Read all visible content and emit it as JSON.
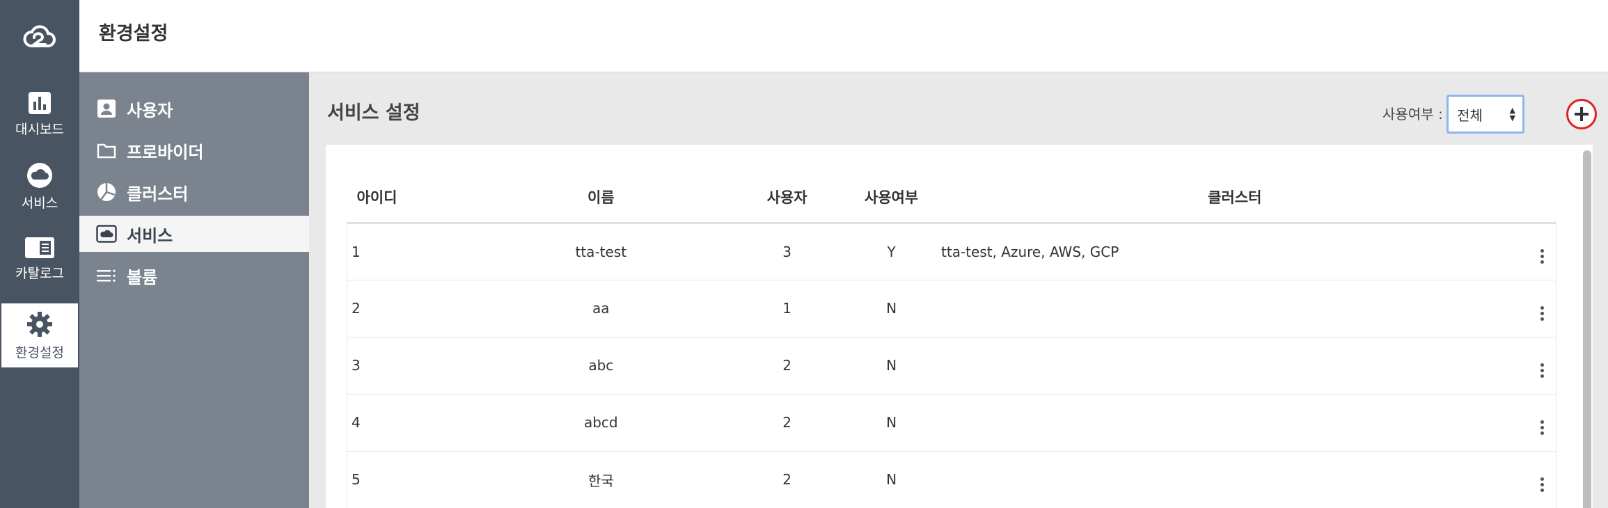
{
  "header": {
    "title": "환경설정"
  },
  "rail": {
    "items": [
      {
        "label": "대시보드",
        "icon": "bar-chart-icon"
      },
      {
        "label": "서비스",
        "icon": "cloud-icon"
      },
      {
        "label": "카탈로그",
        "icon": "catalog-icon"
      },
      {
        "label": "환경설정",
        "icon": "gear-icon",
        "active": true
      }
    ]
  },
  "submenu": {
    "items": [
      {
        "label": "사용자",
        "icon": "user-icon"
      },
      {
        "label": "프로바이더",
        "icon": "folder-icon"
      },
      {
        "label": "클러스터",
        "icon": "pie-icon"
      },
      {
        "label": "서비스",
        "icon": "cloud-box-icon",
        "active": true
      },
      {
        "label": "볼륨",
        "icon": "list-icon"
      }
    ]
  },
  "main": {
    "title": "서비스 설정",
    "filter": {
      "label": "사용여부 :",
      "value": "전체"
    },
    "add_label": "+"
  },
  "table": {
    "headers": {
      "id": "아이디",
      "name": "이름",
      "users": "사용자",
      "use": "사용여부",
      "cluster": "클러스터"
    },
    "rows": [
      {
        "id": "1",
        "name": "tta-test",
        "users": "3",
        "use": "Y",
        "cluster": "tta-test, Azure, AWS, GCP"
      },
      {
        "id": "2",
        "name": "aa",
        "users": "1",
        "use": "N",
        "cluster": ""
      },
      {
        "id": "3",
        "name": "abc",
        "users": "2",
        "use": "N",
        "cluster": ""
      },
      {
        "id": "4",
        "name": "abcd",
        "users": "2",
        "use": "N",
        "cluster": ""
      },
      {
        "id": "5",
        "name": "한국",
        "users": "2",
        "use": "N",
        "cluster": ""
      }
    ]
  },
  "colors": {
    "rail": "#495462",
    "submenu": "#7a838e",
    "main_bg": "#e9e9e9",
    "add_ring": "#e02020",
    "select_border": "#8db6f0"
  }
}
